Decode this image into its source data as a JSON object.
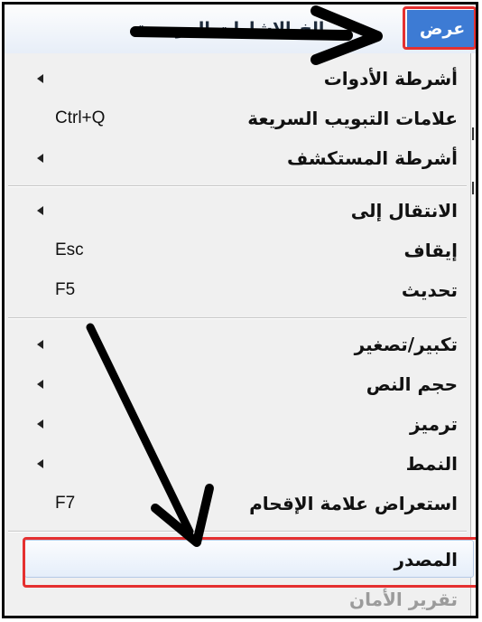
{
  "menubar": {
    "view": "عرض",
    "history": "الخ",
    "bookmarks": "الإشارات المرجعية"
  },
  "menu": {
    "items": [
      {
        "label": "أشرطة الأدوات",
        "shortcut": "",
        "submenu": true
      },
      {
        "label": "علامات التبويب السريعة",
        "shortcut": "Ctrl+Q",
        "submenu": false
      },
      {
        "label": "أشرطة المستكشف",
        "shortcut": "",
        "submenu": true
      },
      {
        "label": "الانتقال إلى",
        "shortcut": "",
        "submenu": true
      },
      {
        "label": "إيقاف",
        "shortcut": "Esc",
        "submenu": false
      },
      {
        "label": "تحديث",
        "shortcut": "F5",
        "submenu": false
      },
      {
        "label": "تكبير/تصغير",
        "shortcut": "",
        "submenu": true
      },
      {
        "label": "حجم النص",
        "shortcut": "",
        "submenu": true
      },
      {
        "label": "ترميز",
        "shortcut": "",
        "submenu": true
      },
      {
        "label": "النمط",
        "shortcut": "",
        "submenu": true
      },
      {
        "label": "استعراض علامة الإقحام",
        "shortcut": "F7",
        "submenu": false
      },
      {
        "label": "المصدر",
        "shortcut": "",
        "submenu": false
      },
      {
        "label": "تقرير الأمان",
        "shortcut": "",
        "submenu": false,
        "disabled": true
      }
    ]
  },
  "colors": {
    "highlight_outline": "#e53030",
    "menubar_selected": "#3d7bd4",
    "arrow": "#000000"
  }
}
